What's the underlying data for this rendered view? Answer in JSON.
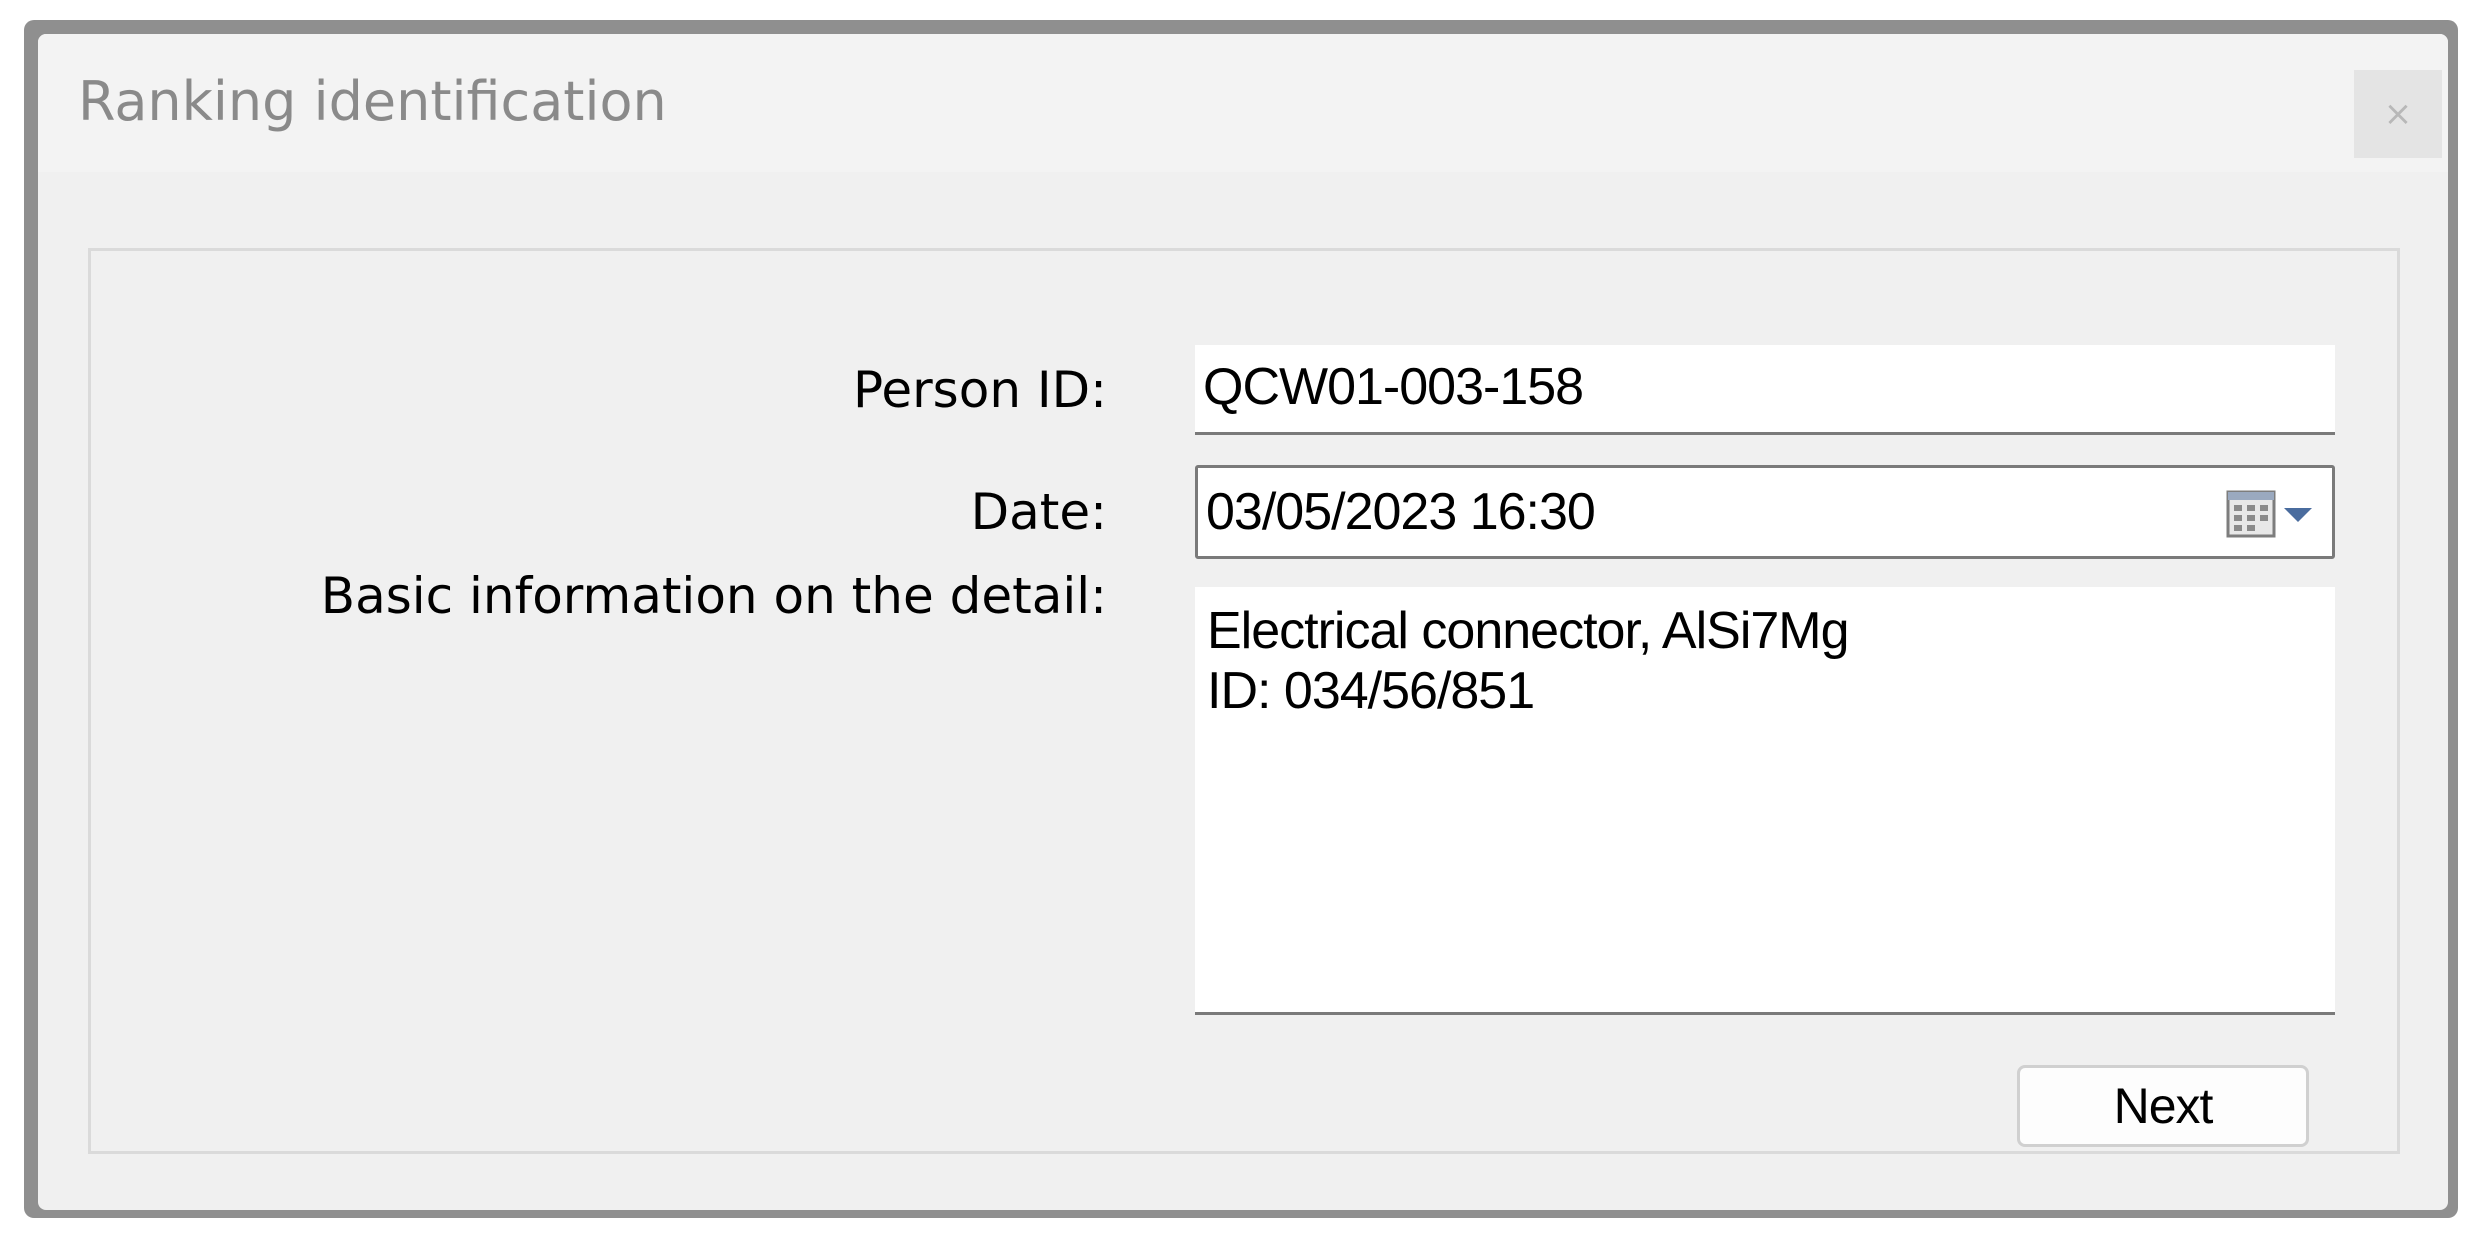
{
  "window": {
    "title": "Ranking identification",
    "close_label": "×"
  },
  "form": {
    "person_id": {
      "label": "Person ID:",
      "value": "QCW01-003-158"
    },
    "date": {
      "label": "Date:",
      "value": "03/05/2023 16:30",
      "picker_icon": "calendar-dropdown-icon"
    },
    "detail": {
      "label": "Basic information on the detail:",
      "lines": [
        "Electrical connector, AlSi7Mg",
        "ID: 034/56/851"
      ]
    },
    "next_label": "Next"
  },
  "colors": {
    "title_text": "#8a8a8a",
    "dialog_bg": "#f0f0f0",
    "field_border": "#7a7a7a",
    "icon_accent": "#4a6c9e"
  }
}
